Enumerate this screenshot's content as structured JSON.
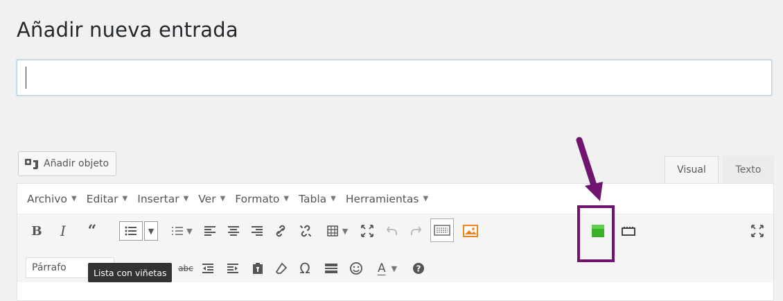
{
  "page": {
    "title": "Añadir nueva entrada"
  },
  "post_title": {
    "value": "",
    "placeholder": ""
  },
  "media": {
    "add_label": "Añadir objeto",
    "icon": "media-icon"
  },
  "tabs": [
    {
      "label": "Visual",
      "active": true
    },
    {
      "label": "Texto",
      "active": false
    }
  ],
  "menubar": {
    "items": [
      {
        "label": "Archivo"
      },
      {
        "label": "Editar"
      },
      {
        "label": "Insertar"
      },
      {
        "label": "Ver"
      },
      {
        "label": "Formato"
      },
      {
        "label": "Tabla"
      },
      {
        "label": "Herramientas"
      }
    ],
    "caret": "▾"
  },
  "toolbar": {
    "row1": [
      {
        "name": "bold",
        "label": "B"
      },
      {
        "name": "italic",
        "label": "I"
      },
      {
        "name": "blockquote",
        "label": "66"
      },
      {
        "name": "bullet-list",
        "icon": "bullet-list-icon",
        "pressed": true
      },
      {
        "name": "numbered-list",
        "icon": "numbered-list-icon"
      },
      {
        "name": "align-left",
        "icon": "align-left-icon"
      },
      {
        "name": "align-center",
        "icon": "align-center-icon"
      },
      {
        "name": "align-right",
        "icon": "align-right-icon"
      },
      {
        "name": "link",
        "icon": "link-icon"
      },
      {
        "name": "unlink",
        "icon": "unlink-icon"
      },
      {
        "name": "table",
        "icon": "table-icon"
      },
      {
        "name": "fullscreen",
        "icon": "fullscreen-icon"
      },
      {
        "name": "undo",
        "icon": "undo-icon"
      },
      {
        "name": "redo",
        "icon": "redo-icon"
      },
      {
        "name": "keyboard",
        "icon": "keyboard-icon"
      },
      {
        "name": "image",
        "icon": "image-icon",
        "color": "#f0821e"
      },
      {
        "name": "green-square",
        "icon": "green-square-icon",
        "color": "#3bb12a"
      },
      {
        "name": "read-more",
        "icon": "read-more-icon"
      },
      {
        "name": "distraction-free",
        "icon": "expand-icon"
      }
    ],
    "row2": {
      "format_select": "Párrafo",
      "tooltip": "Lista con viñetas",
      "text_color_label": "A",
      "omega_label": "Ω",
      "strike_label": "abc"
    }
  },
  "colors": {
    "highlight": "#6f1570",
    "accent_green": "#3bb12a",
    "accent_orange": "#f0821e"
  }
}
